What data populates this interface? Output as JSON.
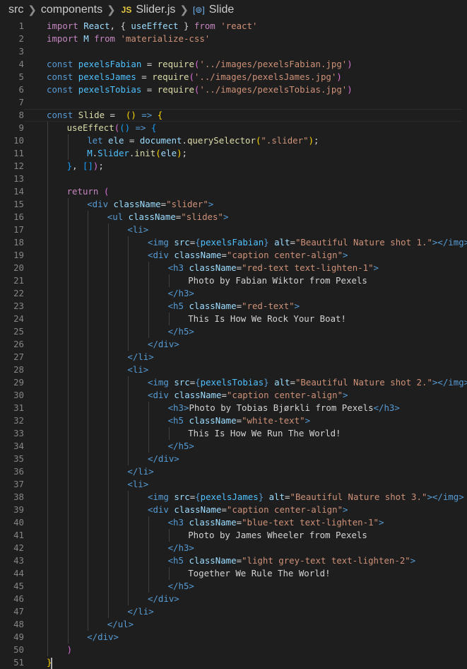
{
  "breadcrumb": {
    "items": [
      "src",
      "components",
      "Slider.js",
      "Slide"
    ],
    "file_icon": "JS",
    "symbol_icon": "[⊚]"
  },
  "colors": {
    "background": "#1e1e1e",
    "keyword": "#c586c0",
    "string": "#ce9178",
    "storage": "#569cd6",
    "variable": "#4fc1ff",
    "function": "#dcdcaa",
    "property": "#9cdcfe",
    "text": "#d4d4d4"
  },
  "code_lines": [
    {
      "n": "1",
      "indent": 0,
      "tokens": [
        [
          "kw",
          "import "
        ],
        [
          "pm",
          "React"
        ],
        [
          "tx",
          ", { "
        ],
        [
          "pm",
          "useEffect"
        ],
        [
          "tx",
          " } "
        ],
        [
          "kw",
          "from "
        ],
        [
          "st",
          "'react'"
        ]
      ]
    },
    {
      "n": "2",
      "indent": 0,
      "tokens": [
        [
          "kw",
          "import "
        ],
        [
          "pm",
          "M"
        ],
        [
          "kw",
          " from "
        ],
        [
          "st",
          "'materialize-css'"
        ]
      ]
    },
    {
      "n": "3",
      "indent": 0,
      "tokens": []
    },
    {
      "n": "4",
      "indent": 0,
      "tokens": [
        [
          "sk",
          "const "
        ],
        [
          "vr",
          "pexelsFabian"
        ],
        [
          "tx",
          " = "
        ],
        [
          "fn",
          "require"
        ],
        [
          "br2",
          "("
        ],
        [
          "st",
          "'../images/pexelsFabian.jpg'"
        ],
        [
          "br2",
          ")"
        ]
      ]
    },
    {
      "n": "5",
      "indent": 0,
      "tokens": [
        [
          "sk",
          "const "
        ],
        [
          "vr",
          "pexelsJames"
        ],
        [
          "tx",
          " = "
        ],
        [
          "fn",
          "require"
        ],
        [
          "br2",
          "("
        ],
        [
          "st",
          "'../images/pexelsJames.jpg'"
        ],
        [
          "br2",
          ")"
        ]
      ]
    },
    {
      "n": "6",
      "indent": 0,
      "tokens": [
        [
          "sk",
          "const "
        ],
        [
          "vr",
          "pexelsTobias"
        ],
        [
          "tx",
          " = "
        ],
        [
          "fn",
          "require"
        ],
        [
          "br2",
          "("
        ],
        [
          "st",
          "'../images/pexelsTobias.jpg'"
        ],
        [
          "br2",
          ")"
        ]
      ]
    },
    {
      "n": "7",
      "indent": 0,
      "tokens": []
    },
    {
      "n": "8",
      "indent": 0,
      "current": true,
      "tokens": [
        [
          "sk",
          "const "
        ],
        [
          "fn",
          "Slide"
        ],
        [
          "tx",
          " =  "
        ],
        [
          "br1",
          "()"
        ],
        [
          "sk",
          " => "
        ],
        [
          "br1",
          "{"
        ]
      ]
    },
    {
      "n": "9",
      "indent": 1,
      "tokens": [
        [
          "fn",
          "useEffect"
        ],
        [
          "br2",
          "("
        ],
        [
          "br3",
          "()"
        ],
        [
          "sk",
          " => "
        ],
        [
          "br3",
          "{"
        ]
      ]
    },
    {
      "n": "10",
      "indent": 2,
      "tokens": [
        [
          "sk",
          "let "
        ],
        [
          "pm",
          "ele"
        ],
        [
          "tx",
          " = "
        ],
        [
          "pm",
          "document"
        ],
        [
          "tx",
          "."
        ],
        [
          "fn",
          "querySelector"
        ],
        [
          "br1",
          "("
        ],
        [
          "st",
          "\".slider\""
        ],
        [
          "br1",
          ")"
        ],
        [
          "tx",
          ";"
        ]
      ]
    },
    {
      "n": "11",
      "indent": 2,
      "tokens": [
        [
          "vr",
          "M"
        ],
        [
          "tx",
          "."
        ],
        [
          "vr",
          "Slider"
        ],
        [
          "tx",
          "."
        ],
        [
          "fn",
          "init"
        ],
        [
          "br1",
          "("
        ],
        [
          "pm",
          "ele"
        ],
        [
          "br1",
          ")"
        ],
        [
          "tx",
          ";"
        ]
      ]
    },
    {
      "n": "12",
      "indent": 1,
      "tokens": [
        [
          "br3",
          "}"
        ],
        [
          "tx",
          ", "
        ],
        [
          "br3",
          "[]"
        ],
        [
          "br2",
          ")"
        ],
        [
          "tx",
          ";"
        ]
      ]
    },
    {
      "n": "13",
      "indent": 1,
      "tokens": []
    },
    {
      "n": "14",
      "indent": 1,
      "tokens": [
        [
          "kw",
          "return "
        ],
        [
          "br2",
          "("
        ]
      ]
    },
    {
      "n": "15",
      "indent": 2,
      "tokens": [
        [
          "tg",
          "<div "
        ],
        [
          "at",
          "className"
        ],
        [
          "tx",
          "="
        ],
        [
          "st",
          "\"slider\""
        ],
        [
          "tg",
          ">"
        ]
      ]
    },
    {
      "n": "16",
      "indent": 3,
      "tokens": [
        [
          "tg",
          "<ul "
        ],
        [
          "at",
          "className"
        ],
        [
          "tx",
          "="
        ],
        [
          "st",
          "\"slides\""
        ],
        [
          "tg",
          ">"
        ]
      ]
    },
    {
      "n": "17",
      "indent": 4,
      "tokens": [
        [
          "tg",
          "<li>"
        ]
      ]
    },
    {
      "n": "18",
      "indent": 5,
      "tokens": [
        [
          "tg",
          "<img "
        ],
        [
          "at",
          "src"
        ],
        [
          "tx",
          "="
        ],
        [
          "sk",
          "{"
        ],
        [
          "vr",
          "pexelsFabian"
        ],
        [
          "sk",
          "}"
        ],
        [
          "at",
          " alt"
        ],
        [
          "tx",
          "="
        ],
        [
          "st",
          "\"Beautiful Nature shot 1.\""
        ],
        [
          "tg",
          "></img>"
        ]
      ]
    },
    {
      "n": "19",
      "indent": 5,
      "tokens": [
        [
          "tg",
          "<div "
        ],
        [
          "at",
          "className"
        ],
        [
          "tx",
          "="
        ],
        [
          "st",
          "\"caption center-align\""
        ],
        [
          "tg",
          ">"
        ]
      ]
    },
    {
      "n": "20",
      "indent": 6,
      "tokens": [
        [
          "tg",
          "<h3 "
        ],
        [
          "at",
          "className"
        ],
        [
          "tx",
          "="
        ],
        [
          "st",
          "\"red-text text-lighten-1\""
        ],
        [
          "tg",
          ">"
        ]
      ]
    },
    {
      "n": "21",
      "indent": 7,
      "tokens": [
        [
          "tx",
          "Photo by Fabian Wiktor from Pexels"
        ]
      ]
    },
    {
      "n": "22",
      "indent": 6,
      "tokens": [
        [
          "tg",
          "</h3>"
        ]
      ]
    },
    {
      "n": "23",
      "indent": 6,
      "tokens": [
        [
          "tg",
          "<h5 "
        ],
        [
          "at",
          "className"
        ],
        [
          "tx",
          "="
        ],
        [
          "st",
          "\"red-text\""
        ],
        [
          "tg",
          ">"
        ]
      ]
    },
    {
      "n": "24",
      "indent": 7,
      "tokens": [
        [
          "tx",
          "This Is How We Rock Your Boat!"
        ]
      ]
    },
    {
      "n": "25",
      "indent": 6,
      "tokens": [
        [
          "tg",
          "</h5>"
        ]
      ]
    },
    {
      "n": "26",
      "indent": 5,
      "tokens": [
        [
          "tg",
          "</div>"
        ]
      ]
    },
    {
      "n": "27",
      "indent": 4,
      "tokens": [
        [
          "tg",
          "</li>"
        ]
      ]
    },
    {
      "n": "28",
      "indent": 4,
      "tokens": [
        [
          "tg",
          "<li>"
        ]
      ]
    },
    {
      "n": "29",
      "indent": 5,
      "tokens": [
        [
          "tg",
          "<img "
        ],
        [
          "at",
          "src"
        ],
        [
          "tx",
          "="
        ],
        [
          "sk",
          "{"
        ],
        [
          "vr",
          "pexelsTobias"
        ],
        [
          "sk",
          "}"
        ],
        [
          "at",
          " alt"
        ],
        [
          "tx",
          "="
        ],
        [
          "st",
          "\"Beautiful Nature shot 2.\""
        ],
        [
          "tg",
          "></img>"
        ]
      ]
    },
    {
      "n": "30",
      "indent": 5,
      "tokens": [
        [
          "tg",
          "<div "
        ],
        [
          "at",
          "className"
        ],
        [
          "tx",
          "="
        ],
        [
          "st",
          "\"caption center-align\""
        ],
        [
          "tg",
          ">"
        ]
      ]
    },
    {
      "n": "31",
      "indent": 6,
      "tokens": [
        [
          "tg",
          "<h3>"
        ],
        [
          "tx",
          "Photo by Tobias Bjørkli from Pexels"
        ],
        [
          "tg",
          "</h3>"
        ]
      ]
    },
    {
      "n": "32",
      "indent": 6,
      "tokens": [
        [
          "tg",
          "<h5 "
        ],
        [
          "at",
          "className"
        ],
        [
          "tx",
          "="
        ],
        [
          "st",
          "\"white-text\""
        ],
        [
          "tg",
          ">"
        ]
      ]
    },
    {
      "n": "33",
      "indent": 7,
      "tokens": [
        [
          "tx",
          "This Is How We Run The World!"
        ]
      ]
    },
    {
      "n": "34",
      "indent": 6,
      "tokens": [
        [
          "tg",
          "</h5>"
        ]
      ]
    },
    {
      "n": "35",
      "indent": 5,
      "tokens": [
        [
          "tg",
          "</div>"
        ]
      ]
    },
    {
      "n": "36",
      "indent": 4,
      "tokens": [
        [
          "tg",
          "</li>"
        ]
      ]
    },
    {
      "n": "37",
      "indent": 4,
      "tokens": [
        [
          "tg",
          "<li>"
        ]
      ]
    },
    {
      "n": "38",
      "indent": 5,
      "tokens": [
        [
          "tg",
          "<img "
        ],
        [
          "at",
          "src"
        ],
        [
          "tx",
          "="
        ],
        [
          "sk",
          "{"
        ],
        [
          "vr",
          "pexelsJames"
        ],
        [
          "sk",
          "}"
        ],
        [
          "at",
          " alt"
        ],
        [
          "tx",
          "="
        ],
        [
          "st",
          "\"Beautiful Nature shot 3.\""
        ],
        [
          "tg",
          "></img>"
        ]
      ]
    },
    {
      "n": "39",
      "indent": 5,
      "tokens": [
        [
          "tg",
          "<div "
        ],
        [
          "at",
          "className"
        ],
        [
          "tx",
          "="
        ],
        [
          "st",
          "\"caption center-align\""
        ],
        [
          "tg",
          ">"
        ]
      ]
    },
    {
      "n": "40",
      "indent": 6,
      "tokens": [
        [
          "tg",
          "<h3 "
        ],
        [
          "at",
          "className"
        ],
        [
          "tx",
          "="
        ],
        [
          "st",
          "\"blue-text text-lighten-1\""
        ],
        [
          "tg",
          ">"
        ]
      ]
    },
    {
      "n": "41",
      "indent": 7,
      "tokens": [
        [
          "tx",
          "Photo by James Wheeler from Pexels"
        ]
      ]
    },
    {
      "n": "42",
      "indent": 6,
      "tokens": [
        [
          "tg",
          "</h3>"
        ]
      ]
    },
    {
      "n": "43",
      "indent": 6,
      "tokens": [
        [
          "tg",
          "<h5 "
        ],
        [
          "at",
          "className"
        ],
        [
          "tx",
          "="
        ],
        [
          "st",
          "\"light grey-text text-lighten-2\""
        ],
        [
          "tg",
          ">"
        ]
      ]
    },
    {
      "n": "44",
      "indent": 7,
      "tokens": [
        [
          "tx",
          "Together We Rule The World!"
        ]
      ]
    },
    {
      "n": "45",
      "indent": 6,
      "tokens": [
        [
          "tg",
          "</h5>"
        ]
      ]
    },
    {
      "n": "46",
      "indent": 5,
      "tokens": [
        [
          "tg",
          "</div>"
        ]
      ]
    },
    {
      "n": "47",
      "indent": 4,
      "tokens": [
        [
          "tg",
          "</li>"
        ]
      ]
    },
    {
      "n": "48",
      "indent": 3,
      "tokens": [
        [
          "tg",
          "</ul>"
        ]
      ]
    },
    {
      "n": "49",
      "indent": 2,
      "tokens": [
        [
          "tg",
          "</div>"
        ]
      ]
    },
    {
      "n": "50",
      "indent": 1,
      "tokens": [
        [
          "br2",
          ")"
        ]
      ]
    },
    {
      "n": "51",
      "indent": 0,
      "cursor": true,
      "tokens": [
        [
          "br1",
          "}"
        ]
      ]
    }
  ]
}
